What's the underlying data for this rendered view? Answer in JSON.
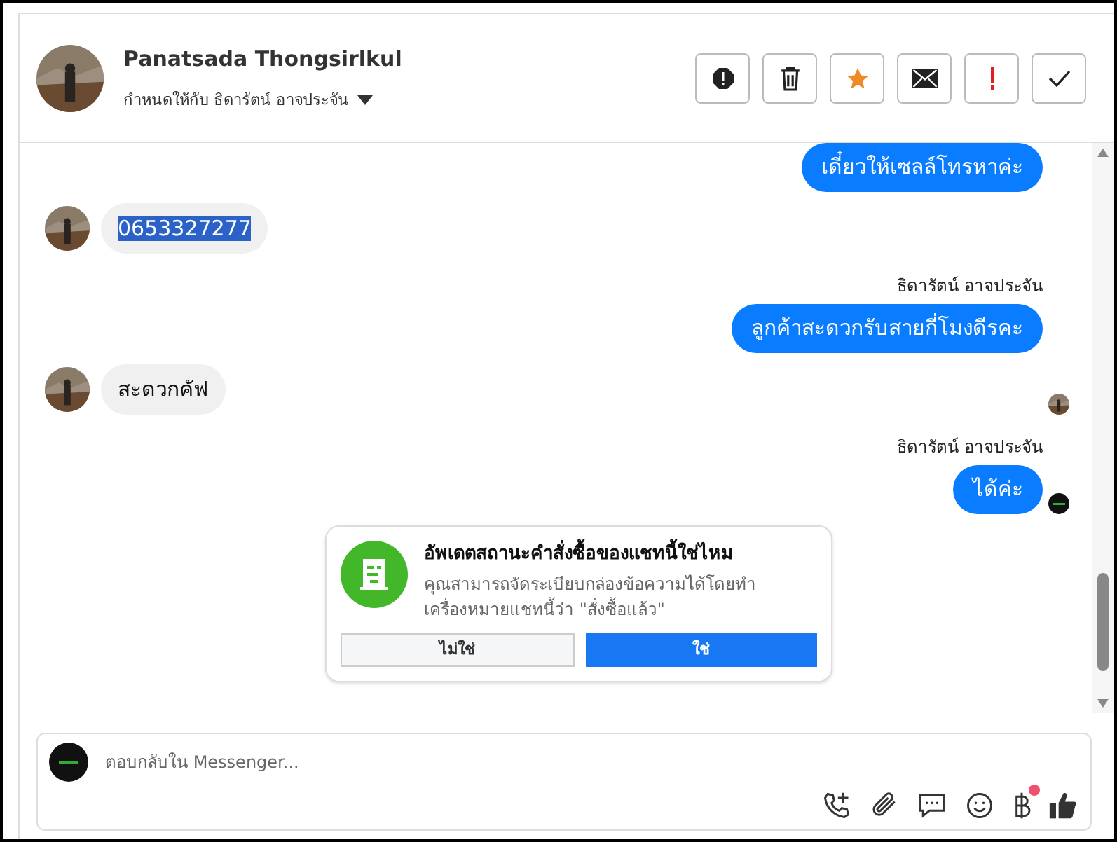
{
  "header": {
    "name": "Panatsada Thongsirlkul",
    "assigned": "กำหนดให้กับ ธิดารัตน์ อาจประจัน",
    "actions": [
      {
        "kind": "spam"
      },
      {
        "kind": "trash"
      },
      {
        "kind": "star"
      },
      {
        "kind": "mail"
      },
      {
        "kind": "important"
      },
      {
        "kind": "done"
      }
    ]
  },
  "messages": [
    {
      "kind": "outgoing",
      "text": "เดี๋ยวให้เซลล์โทรหาค่ะ"
    },
    {
      "kind": "incoming",
      "text": "0653327277",
      "selected": true
    },
    {
      "kind": "sender",
      "text": "ธิดารัตน์ อาจประจัน"
    },
    {
      "kind": "outgoing",
      "text": "ลูกค้าสะดวกรับสายกี่โมงดีรคะ"
    },
    {
      "kind": "incoming",
      "text": "สะดวกคัฟ",
      "selected": false,
      "read_by_contact": true
    },
    {
      "kind": "sender",
      "text": "ธิดารัตน์ อาจประจัน"
    },
    {
      "kind": "outgoing",
      "text": "ได้ค่ะ",
      "read_by_page": true
    }
  ],
  "prompt": {
    "title": "อัพเดตสถานะคำสั่งซื้อของแชทนี้ใช่ไหม",
    "body": "คุณสามารถจัดระเบียบกล่องข้อความได้โดยทำเครื่องหมายแชทนี้ว่า \"สั่งซื้อแล้ว\"",
    "buttons": [
      {
        "label": "ไม่ใช่",
        "primary": false
      },
      {
        "label": "ใช่",
        "primary": true
      }
    ]
  },
  "composer": {
    "placeholder": "ตอบกลับใน Messenger...",
    "tools": [
      {
        "kind": "call"
      },
      {
        "kind": "attach"
      },
      {
        "kind": "reply"
      },
      {
        "kind": "emoji"
      },
      {
        "kind": "baht",
        "badge": true
      },
      {
        "kind": "like"
      }
    ]
  }
}
